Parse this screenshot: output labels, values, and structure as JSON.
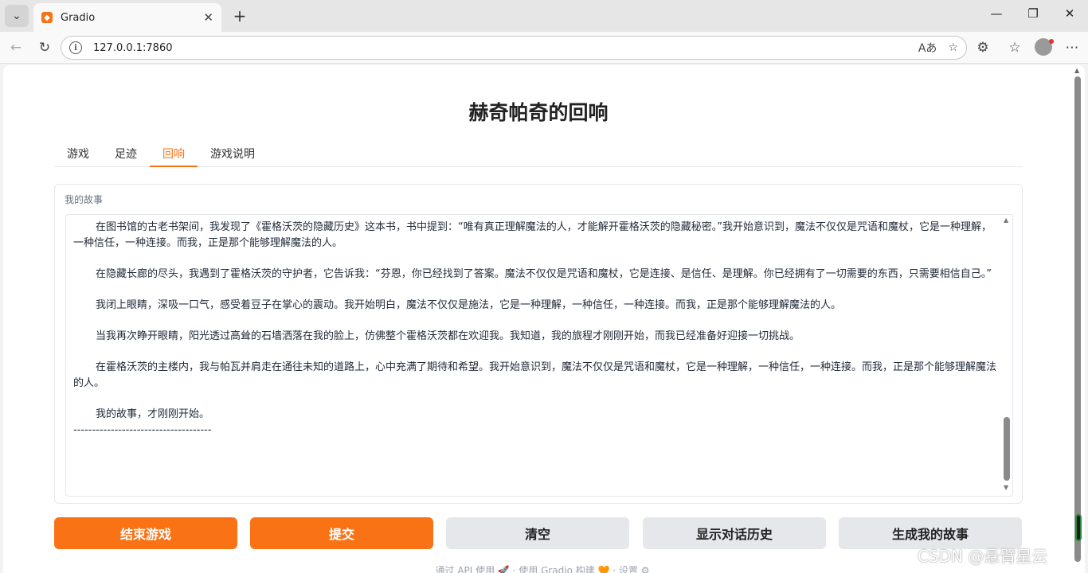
{
  "browser": {
    "tab_title": "Gradio",
    "url": "127.0.0.1:7860"
  },
  "app": {
    "title": "赫奇帕奇的回响",
    "tabs": [
      "游戏",
      "足迹",
      "回响",
      "游戏说明"
    ],
    "active_tab": "回响",
    "accent_color": "#f97316"
  },
  "story_block": {
    "label": "我的故事",
    "paragraphs": [
      "在图书馆的古老书架间，我发现了《霍格沃茨的隐藏历史》这本书，书中提到：“唯有真正理解魔法的人，才能解开霍格沃茨的隐藏秘密。”我开始意识到，魔法不仅仅是咒语和魔杖，它是一种理解，一种信任，一种连接。而我，正是那个能够理解魔法的人。",
      "在隐藏长廊的尽头，我遇到了霍格沃茨的守护者，它告诉我：“芬恩，你已经找到了答案。魔法不仅仅是咒语和魔杖，它是连接、是信任、是理解。你已经拥有了一切需要的东西，只需要相信自己。”",
      "我闭上眼睛，深吸一口气，感受着豆子在掌心的震动。我开始明白，魔法不仅仅是施法，它是一种理解，一种信任，一种连接。而我，正是那个能够理解魔法的人。",
      "当我再次睁开眼睛，阳光透过高耸的石墙洒落在我的脸上，仿佛整个霍格沃茨都在欢迎我。我知道，我的旅程才刚刚开始，而我已经准备好迎接一切挑战。",
      "在霍格沃茨的主楼内，我与帕瓦并肩走在通往未知的道路上，心中充满了期待和希望。我开始意识到，魔法不仅仅是咒语和魔杖，它是一种理解，一种信任，一种连接。而我，正是那个能够理解魔法的人。",
      "我的故事，才刚刚开始。"
    ],
    "separator": "-------------------------------------"
  },
  "buttons": {
    "end_game": "结束游戏",
    "submit": "提交",
    "clear": "清空",
    "show_history": "显示对话历史",
    "generate_story": "生成我的故事"
  },
  "footer": {
    "text": "通过 API 使用 🚀 · 使用 Gradio 构建 🧡 · 设置 ⚙"
  },
  "watermark": "CSDN @悬臂星云"
}
